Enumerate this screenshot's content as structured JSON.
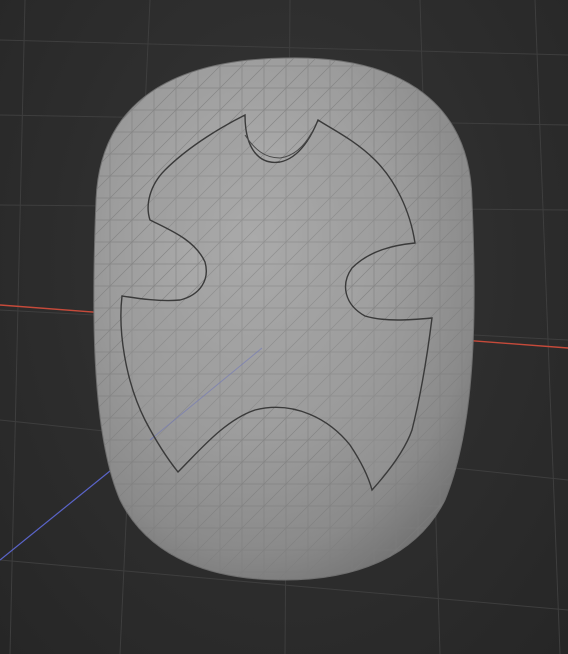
{
  "viewport": {
    "background_color": "#2b2b2b",
    "grid_color": "#3e3e3e",
    "x_axis_color": "#c64a3a",
    "z_axis_color": "#5a64c8"
  },
  "mesh": {
    "shape": "rounded capsule with raised batman-style emblem",
    "surface_color": "#9a9a9a",
    "wire_color": "#7d7d7d",
    "emblem_outline_color": "#3a3a3a"
  }
}
